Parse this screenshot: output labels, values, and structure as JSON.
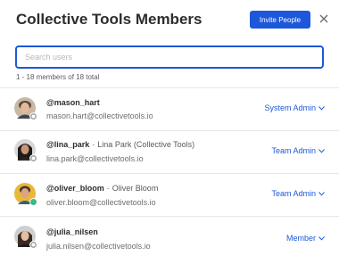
{
  "modal": {
    "title": "Collective Tools Members",
    "invite_label": "Invite People",
    "close_icon": "close-icon"
  },
  "search": {
    "placeholder": "Search users"
  },
  "member_count": "1 - 18 members of 18 total",
  "members": [
    {
      "username": "@mason_hart",
      "fullname": "",
      "email": "mason.hart@collectivetools.io",
      "role": "System Admin",
      "status": "away"
    },
    {
      "username": "@lina_park",
      "fullname": "Lina Park (Collective Tools)",
      "email": "lina.park@collectivetools.io",
      "role": "Team Admin",
      "status": "away"
    },
    {
      "username": "@oliver_bloom",
      "fullname": "Oliver Bloom",
      "email": "oliver.bloom@collectivetools.io",
      "role": "Team Admin",
      "status": "online"
    },
    {
      "username": "@julia_nilsen",
      "fullname": "",
      "email": "julia.nilsen@collectivetools.io",
      "role": "Member",
      "status": "away"
    }
  ],
  "colors": {
    "accent": "#1c58d9",
    "online": "#3db887"
  }
}
